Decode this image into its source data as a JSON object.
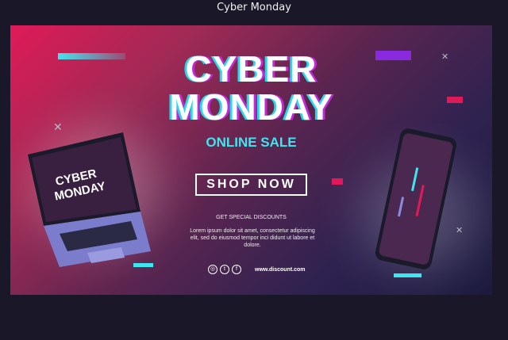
{
  "page_title": "Cyber Monday",
  "banner": {
    "headline_line1": "CYBER",
    "headline_line2": "MONDAY",
    "subheadline": "ONLINE SALE",
    "cta_label": "SHOP NOW",
    "discount_heading": "GET SPECIAL DISCOUNTS",
    "body_text": "Lorem ipsum dolor sit amet, consectetur adipiscing elit, sed do eiusmod tempor inci didunt ut labore et dolore.",
    "website": "www.discount.com",
    "laptop_screen_text_1": "CYBER",
    "laptop_screen_text_2": "MONDAY",
    "social_icons": [
      "instagram-icon",
      "twitter-icon",
      "facebook-icon"
    ],
    "colors": {
      "accent_cyan": "#3ee6ef",
      "accent_pink": "#e01a58",
      "accent_purple": "#c22ad8"
    }
  }
}
